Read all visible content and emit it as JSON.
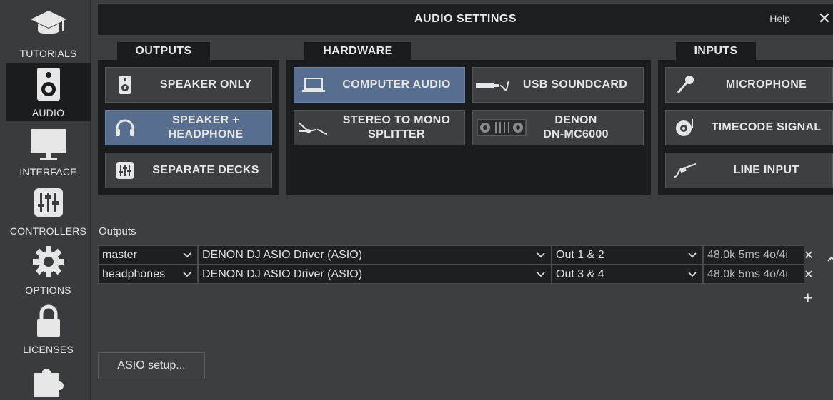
{
  "sidebar": {
    "items": [
      {
        "label": "TUTORIALS",
        "icon": "graduation-cap-icon",
        "active": false
      },
      {
        "label": "AUDIO",
        "icon": "speaker-icon",
        "active": true
      },
      {
        "label": "INTERFACE",
        "icon": "monitor-icon",
        "active": false
      },
      {
        "label": "CONTROLLERS",
        "icon": "sliders-icon",
        "active": false
      },
      {
        "label": "OPTIONS",
        "icon": "gear-icon",
        "active": false
      },
      {
        "label": "LICENSES",
        "icon": "lock-icon",
        "active": false
      },
      {
        "label": "",
        "icon": "puzzle-icon",
        "active": false
      }
    ]
  },
  "window": {
    "title": "AUDIO SETTINGS",
    "help": "Help",
    "close": "✕"
  },
  "outputs_panel": {
    "tab": "OUTPUTS",
    "buttons": [
      {
        "label": "SPEAKER ONLY",
        "icon": "speaker-icon",
        "selected": false
      },
      {
        "label": "SPEAKER +\nHEADPHONE",
        "icon": "headphone-icon",
        "selected": true
      },
      {
        "label": "SEPARATE DECKS",
        "icon": "mixer-icon",
        "selected": false
      }
    ]
  },
  "hardware_panel": {
    "tab": "HARDWARE",
    "buttons": [
      {
        "label": "COMPUTER AUDIO",
        "icon": "laptop-icon",
        "selected": true
      },
      {
        "label": "USB SOUNDCARD",
        "icon": "usb-soundcard-icon",
        "selected": false
      },
      {
        "label": "STEREO TO MONO\nSPLITTER",
        "icon": "splitter-cable-icon",
        "selected": false
      },
      {
        "label": "DENON\nDN-MC6000",
        "icon": "controller-device-icon",
        "selected": false
      }
    ]
  },
  "inputs_panel": {
    "tab": "INPUTS",
    "buttons": [
      {
        "label": "MICROPHONE",
        "icon": "microphone-icon",
        "selected": false
      },
      {
        "label": "TIMECODE SIGNAL",
        "icon": "turntable-icon",
        "selected": false
      },
      {
        "label": "LINE INPUT",
        "icon": "cable-jack-icon",
        "selected": false
      }
    ]
  },
  "outputs_table": {
    "label": "Outputs",
    "rows": [
      {
        "channel": "master",
        "driver": "DENON DJ ASIO Driver (ASIO)",
        "ports": "Out 1 & 2",
        "info": "48.0k 5ms 4o/4i"
      },
      {
        "channel": "headphones",
        "driver": "DENON DJ ASIO Driver (ASIO)",
        "ports": "Out 3 & 4",
        "info": "48.0k 5ms 4o/4i"
      }
    ],
    "remove": "✕",
    "add": "+"
  },
  "asio_button": "ASIO setup..."
}
